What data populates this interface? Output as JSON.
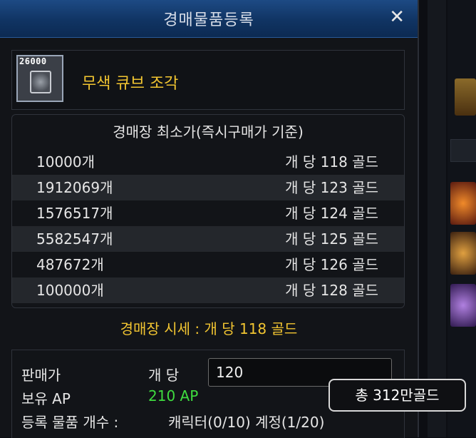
{
  "window": {
    "title": "경매물품등록",
    "close_glyph": "✕"
  },
  "item": {
    "icon_quantity": "26000",
    "icon": "cube-fragment-icon",
    "name": "무색 큐브 조각"
  },
  "price_table": {
    "header": "경매장 최소가(즉시구매가 기준)",
    "rows": [
      {
        "quantity": "10000개",
        "price": "개 당 118 골드"
      },
      {
        "quantity": "1912069개",
        "price": "개 당 123 골드"
      },
      {
        "quantity": "1576517개",
        "price": "개 당 124 골드"
      },
      {
        "quantity": "5582547개",
        "price": "개 당 125 골드"
      },
      {
        "quantity": "487672개",
        "price": "개 당 126 골드"
      },
      {
        "quantity": "100000개",
        "price": "개 당 128 골드"
      }
    ]
  },
  "market_price": "경매장 시세 : 개 당 118 골드",
  "sell": {
    "price_label": "판매가",
    "per_unit_label": "개 당",
    "price_value": "120",
    "ap_label": "보유 AP",
    "ap_value": "210 AP",
    "count_label": "등록 물품 개수 :",
    "count_value": "캐릭터(0/10) 계정(1/20)"
  },
  "tooltip": {
    "total": "총 312만골드"
  },
  "colors": {
    "title_bar": "#103463",
    "gold_text": "#f2c531",
    "ap_green": "#3fdc3f"
  }
}
